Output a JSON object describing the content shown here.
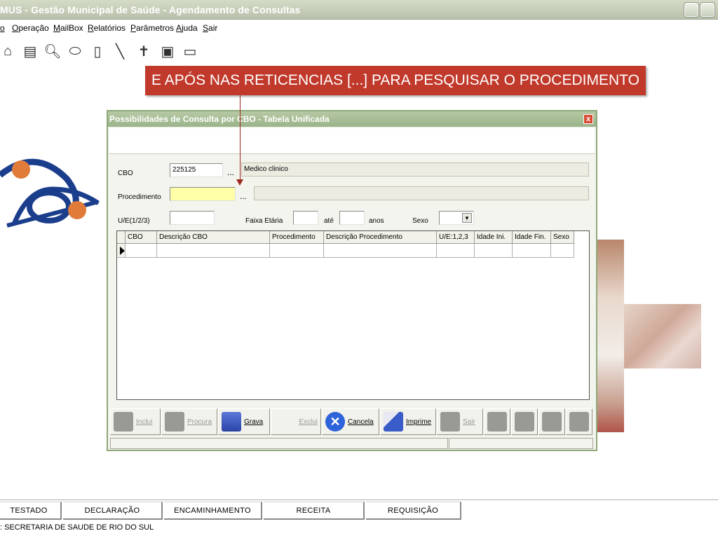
{
  "window": {
    "title": "MUS - Gestão Municipal de Saúde - Agendamento de Consultas"
  },
  "menu": {
    "items": [
      "o",
      "Operação",
      "MailBox",
      "Relatórios",
      "Parâmetros",
      "Ajuda",
      "Sair"
    ]
  },
  "toolbar": {
    "icons": [
      "home-icon",
      "printer-icon",
      "search-doc-icon",
      "pill-icon",
      "clipboard-icon",
      "syringe-icon",
      "cross-icon",
      "medkit-icon",
      "ambulance-icon"
    ]
  },
  "callout": {
    "text": "E APÓS NAS RETICENCIAS [...] PARA PESQUISAR O PROCEDIMENTO",
    "color": "#c0392b"
  },
  "dialog": {
    "title": "Possibilidades de Consulta por CBO - Tabela Unificada",
    "close": "x",
    "cbo_label": "CBO",
    "cbo_code": "225125",
    "cbo_lookup": "...",
    "cbo_description": "Medico clinico",
    "procedimento_label": "Procedimento",
    "procedimento_value": "",
    "procedimento_lookup": "...",
    "procedimento_description": "",
    "ue_label": "U/E(1/2/3)",
    "faixa_label": "Faixa Etária",
    "ate_label": "até",
    "anos_label": "anos",
    "sexo_label": "Sexo",
    "grid_columns": [
      "CBO",
      "Descrição CBO",
      "Procedimento",
      "Descrição Procedimento",
      "U/E:1,2,3",
      "Idade Ini.",
      "Idade Fin.",
      "Sexo"
    ],
    "buttons": {
      "incluir": "Inclui",
      "procura": "Procura",
      "grava": "Grava",
      "exclui": "Exclui",
      "cancela": "Cancela",
      "imprime": "Imprime",
      "sair": "Sair"
    }
  },
  "bottom_buttons": [
    "TESTADO",
    "DECLARAÇÃO",
    "ENCAMINHAMENTO",
    "RECEITA",
    "REQUISIÇÃO"
  ],
  "footer": {
    "text": ": SECRETARIA DE SAUDE DE RIO DO SUL"
  }
}
